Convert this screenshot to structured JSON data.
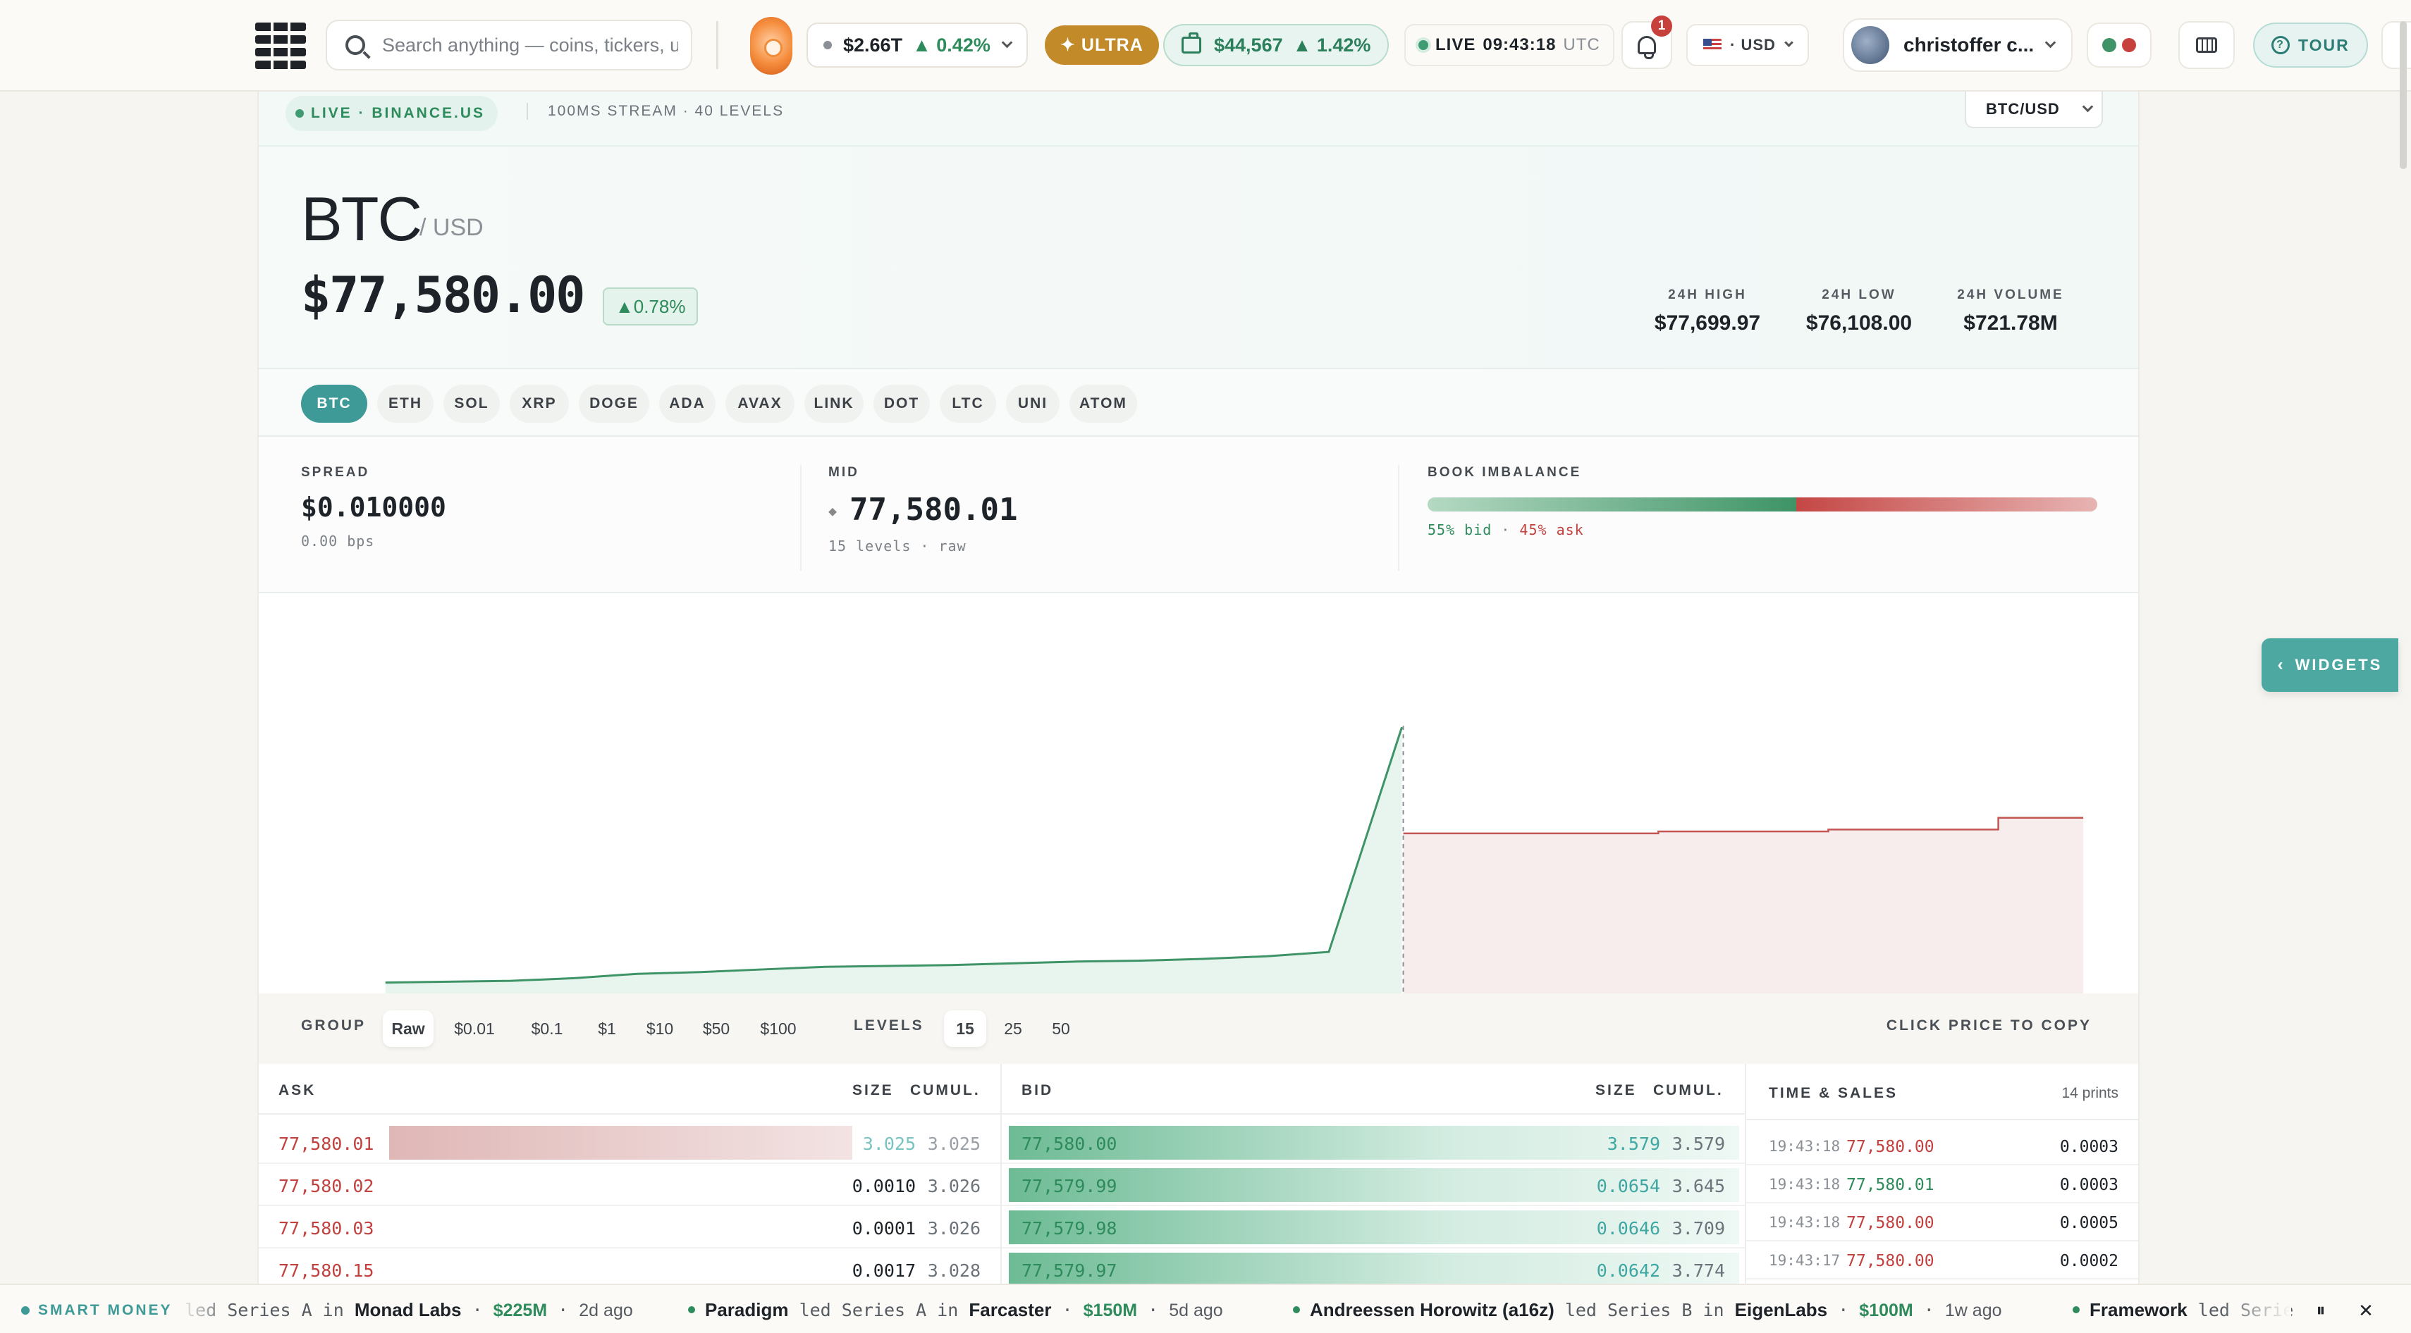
{
  "topbar": {
    "search_placeholder": "Search anything — coins, tickers, u",
    "market_cap": "$2.66T",
    "market_change": "▲ 0.42%",
    "ultra_label": "✦ ULTRA",
    "portfolio_value": "$44,567",
    "portfolio_change": "▲ 1.42%",
    "live_label": "LIVE",
    "clock": "09:43:18",
    "clock_tz": "UTC",
    "notifications": "1",
    "currency": "· USD",
    "user_name": "christoffer c...",
    "tour_label": "TOUR",
    "icons": [
      "search-icon",
      "bell-icon",
      "keyboard-icon",
      "help-icon",
      "portfolio-icon"
    ]
  },
  "status": {
    "live": "LIVE · BINANCE.US",
    "stream": "100MS STREAM · 40 LEVELS",
    "pair_select": "BTC/USD"
  },
  "hero": {
    "symbol": "BTC",
    "quote": "/ USD",
    "price": "$77,580.00",
    "change": "▲0.78%",
    "stats": [
      {
        "label": "24H HIGH",
        "value": "$77,699.97"
      },
      {
        "label": "24H LOW",
        "value": "$76,108.00"
      },
      {
        "label": "24H VOLUME",
        "value": "$721.78M"
      }
    ]
  },
  "assets": [
    "BTC",
    "ETH",
    "SOL",
    "XRP",
    "DOGE",
    "ADA",
    "AVAX",
    "LINK",
    "DOT",
    "LTC",
    "UNI",
    "ATOM"
  ],
  "active_asset": "BTC",
  "metrics": {
    "spread_label": "SPREAD",
    "spread_value": "$0.010000",
    "spread_bps": "0.00 bps",
    "mid_label": "MID",
    "mid_value": "77,580.01",
    "mid_sub": "15 levels · raw",
    "imbalance_label": "BOOK IMBALANCE",
    "bid_pct": 55,
    "ask_pct": 45,
    "imbalance_bid_text": "55% bid",
    "imbalance_ask_text": "45% ask"
  },
  "depth_chart": {
    "bid_cumulative_shape": [
      0.0,
      0.01,
      0.02,
      0.05,
      0.1,
      0.12,
      0.15,
      0.18,
      0.19,
      0.2,
      0.22,
      0.24,
      0.25,
      0.27,
      0.3,
      0.35,
      1.0
    ],
    "ask_cumulative_shape": [
      0.7,
      0.7,
      0.7,
      0.71,
      0.71,
      0.72,
      0.72,
      0.78,
      0.78
    ]
  },
  "group": {
    "label": "GROUP",
    "options": [
      "Raw",
      "$0.01",
      "$0.1",
      "$1",
      "$10",
      "$50",
      "$100"
    ],
    "active": "Raw",
    "levels_label": "LEVELS",
    "levels": [
      "15",
      "25",
      "50"
    ],
    "levels_active": "15",
    "hint": "CLICK PRICE TO COPY"
  },
  "asks": {
    "header": {
      "side": "ASK",
      "size": "SIZE",
      "cumul": "CUMUL."
    },
    "rows": [
      {
        "price": "77,580.01",
        "size": "3.025",
        "cumul": "3.025",
        "depth": 1.0
      },
      {
        "price": "77,580.02",
        "size": "0.0010",
        "cumul": "3.026",
        "depth": 0.0
      },
      {
        "price": "77,580.03",
        "size": "0.0001",
        "cumul": "3.026",
        "depth": 0.0
      },
      {
        "price": "77,580.15",
        "size": "0.0017",
        "cumul": "3.028",
        "depth": 0.0
      }
    ]
  },
  "bids": {
    "header": {
      "side": "BID",
      "size": "SIZE",
      "cumul": "CUMUL."
    },
    "rows": [
      {
        "price": "77,580.00",
        "size": "3.579",
        "cumul": "3.579",
        "depth": 1.0
      },
      {
        "price": "77,579.99",
        "size": "0.0654",
        "cumul": "3.645",
        "depth": 1.0
      },
      {
        "price": "77,579.98",
        "size": "0.0646",
        "cumul": "3.709",
        "depth": 1.0
      },
      {
        "price": "77,579.97",
        "size": "0.0642",
        "cumul": "3.774",
        "depth": 1.0
      }
    ]
  },
  "time_sales": {
    "title": "TIME & SALES",
    "count": "14 prints",
    "rows": [
      {
        "time": "19:43:18",
        "price": "77,580.00",
        "size": "0.0003",
        "side": "sell"
      },
      {
        "time": "19:43:18",
        "price": "77,580.01",
        "size": "0.0003",
        "side": "buy"
      },
      {
        "time": "19:43:18",
        "price": "77,580.00",
        "size": "0.0005",
        "side": "sell"
      },
      {
        "time": "19:43:17",
        "price": "77,580.00",
        "size": "0.0002",
        "side": "sell"
      }
    ]
  },
  "widgets_label": "WIDGETS",
  "ticker": {
    "label": "SMART MONEY",
    "items": [
      {
        "investor": "",
        "text": "led Series A in",
        "company": "Monad Labs",
        "amount": "$225M",
        "ago": "2d ago"
      },
      {
        "investor": "Paradigm",
        "text": "led Series A in",
        "company": "Farcaster",
        "amount": "$150M",
        "ago": "5d ago"
      },
      {
        "investor": "Andreessen Horowitz (a16z)",
        "text": "led Series B in",
        "company": "EigenLabs",
        "amount": "$100M",
        "ago": "1w ago"
      },
      {
        "investor": "Framework",
        "text": "led Serie",
        "company": "",
        "amount": "",
        "ago": ""
      }
    ]
  },
  "colors": {
    "accent": "#3e9a97",
    "bid": "#2e8b5b",
    "ask": "#c2413f",
    "ultra": "#c38a2a"
  }
}
